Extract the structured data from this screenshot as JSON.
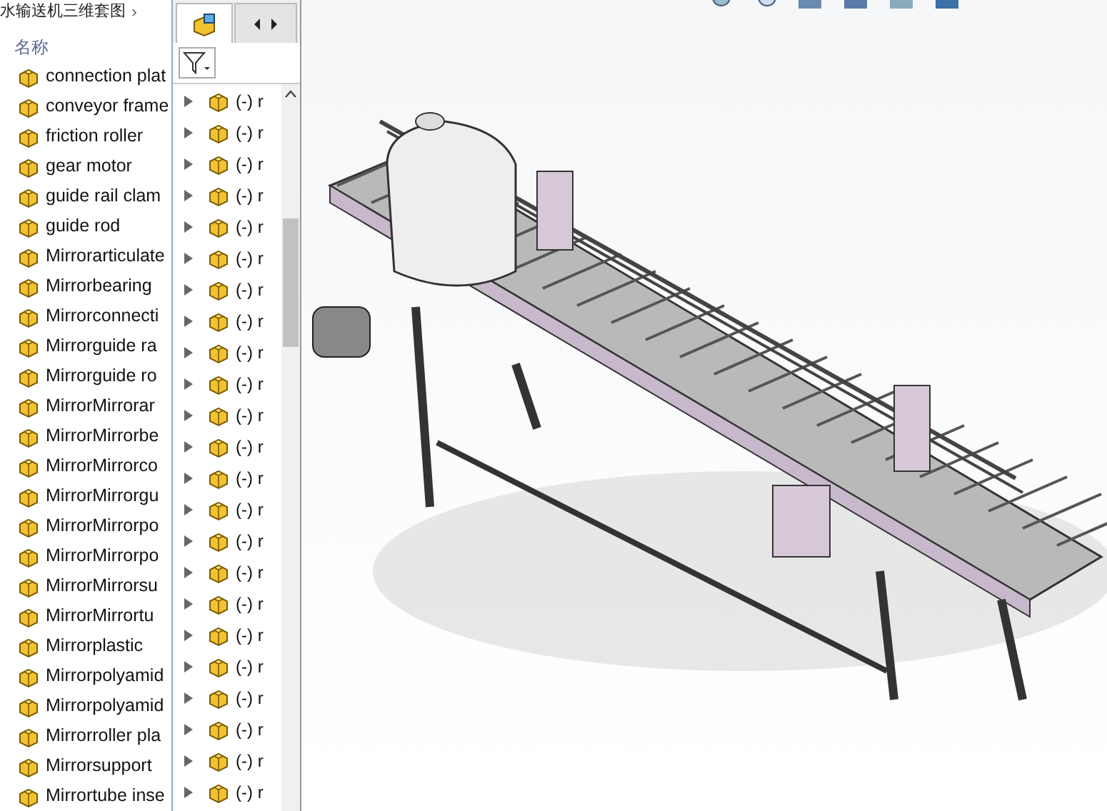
{
  "explorer": {
    "breadcrumb": "水输送机三维套图",
    "breadcrumb_separator": "›",
    "column_header": "名称",
    "files": [
      {
        "name": "connection plat"
      },
      {
        "name": "conveyor frame"
      },
      {
        "name": "friction roller"
      },
      {
        "name": "gear motor"
      },
      {
        "name": "guide rail clam"
      },
      {
        "name": "guide rod"
      },
      {
        "name": "Mirrorarticulate"
      },
      {
        "name": "Mirrorbearing"
      },
      {
        "name": "Mirrorconnecti"
      },
      {
        "name": "Mirrorguide ra"
      },
      {
        "name": "Mirrorguide ro"
      },
      {
        "name": "MirrorMirrorar"
      },
      {
        "name": "MirrorMirrorbe"
      },
      {
        "name": "MirrorMirrorco"
      },
      {
        "name": "MirrorMirrorgu"
      },
      {
        "name": "MirrorMirrorpo"
      },
      {
        "name": "MirrorMirrorpo"
      },
      {
        "name": "MirrorMirrorsu"
      },
      {
        "name": "MirrorMirrortu"
      },
      {
        "name": "Mirrorplastic"
      },
      {
        "name": "Mirrorpolyamid"
      },
      {
        "name": "Mirrorpolyamid"
      },
      {
        "name": "Mirrorroller pla"
      },
      {
        "name": "Mirrorsupport"
      },
      {
        "name": "Mirrortube inse"
      }
    ]
  },
  "feature_tree": {
    "tabs": [
      {
        "kind": "parts",
        "selected": true
      },
      {
        "kind": "nav",
        "selected": false
      }
    ],
    "rows": [
      {
        "label": "(-) r"
      },
      {
        "label": "(-) r"
      },
      {
        "label": "(-) r"
      },
      {
        "label": "(-) r"
      },
      {
        "label": "(-) r"
      },
      {
        "label": "(-) r"
      },
      {
        "label": "(-) r"
      },
      {
        "label": "(-) r"
      },
      {
        "label": "(-) r"
      },
      {
        "label": "(-) r"
      },
      {
        "label": "(-) r"
      },
      {
        "label": "(-) r"
      },
      {
        "label": "(-) r"
      },
      {
        "label": "(-) r"
      },
      {
        "label": "(-) r"
      },
      {
        "label": "(-) r"
      },
      {
        "label": "(-) r"
      },
      {
        "label": "(-) r"
      },
      {
        "label": "(-) r"
      },
      {
        "label": "(-) r"
      },
      {
        "label": "(-) r"
      },
      {
        "label": "(-) r"
      },
      {
        "label": "(-) r"
      }
    ]
  }
}
